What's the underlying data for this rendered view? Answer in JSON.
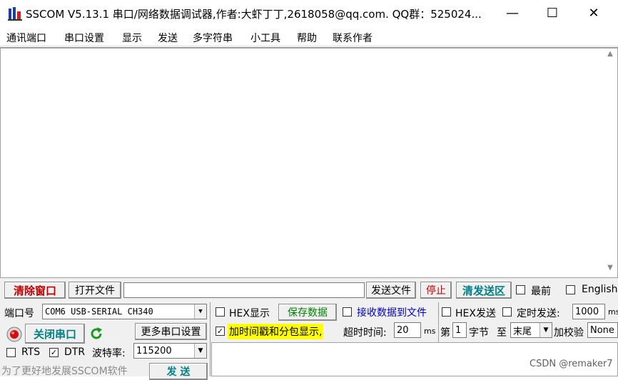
{
  "window": {
    "title": "SSCOM V5.13.1 串口/网络数据调试器,作者:大虾丁丁,2618058@qq.com. QQ群：525024...",
    "minimize": "—",
    "maximize": "☐",
    "close": "✕"
  },
  "menu": [
    "通讯端口",
    "串口设置",
    "显示",
    "发送",
    "多字符串",
    "小工具",
    "帮助",
    "联系作者"
  ],
  "receive": {
    "content": "",
    "scroll_up": "▲",
    "scroll_down": "▼"
  },
  "toolbar": {
    "clear_window": "清除窗口",
    "open_file": "打开文件",
    "file_path": "",
    "send_file": "发送文件",
    "stop": "停止",
    "clear_send": "清发送区",
    "topmost_label": "最前",
    "english_label": "English"
  },
  "port": {
    "port_label": "端口号",
    "port_value": "COM6 USB-SERIAL CH340",
    "open_close_button": "关闭串口",
    "more_settings": "更多串口设置",
    "rts_label": "RTS",
    "dtr_label": "DTR",
    "dtr_checked": "✓",
    "baud_label": "波特率:",
    "baud_value": "115200",
    "promo": "为了更好地发展SSCOM软件",
    "send_button": "发 送"
  },
  "options": {
    "hex_display": "HEX显示",
    "save_data": "保存数据",
    "receive_to_file": "接收数据到文件",
    "hex_send": "HEX发送",
    "timed_send": "定时发送:",
    "timed_value": "1000",
    "timed_unit": "ms",
    "timestamp_label": "加时间戳和分包显示,",
    "timestamp_checked": "✓",
    "timeout_label": "超时时间:",
    "timeout_value": "20",
    "timeout_unit": "ms",
    "byte_prefix": "第",
    "byte_index": "1",
    "byte_label": "字节",
    "to_label": "至",
    "end_value": "末尾",
    "checksum_label": "加校验",
    "checksum_value": "None"
  },
  "watermark": "CSDN @remaker7",
  "colors": {
    "red_text": "#c00000",
    "teal_text": "#00808a",
    "highlight": "#ffff00"
  }
}
